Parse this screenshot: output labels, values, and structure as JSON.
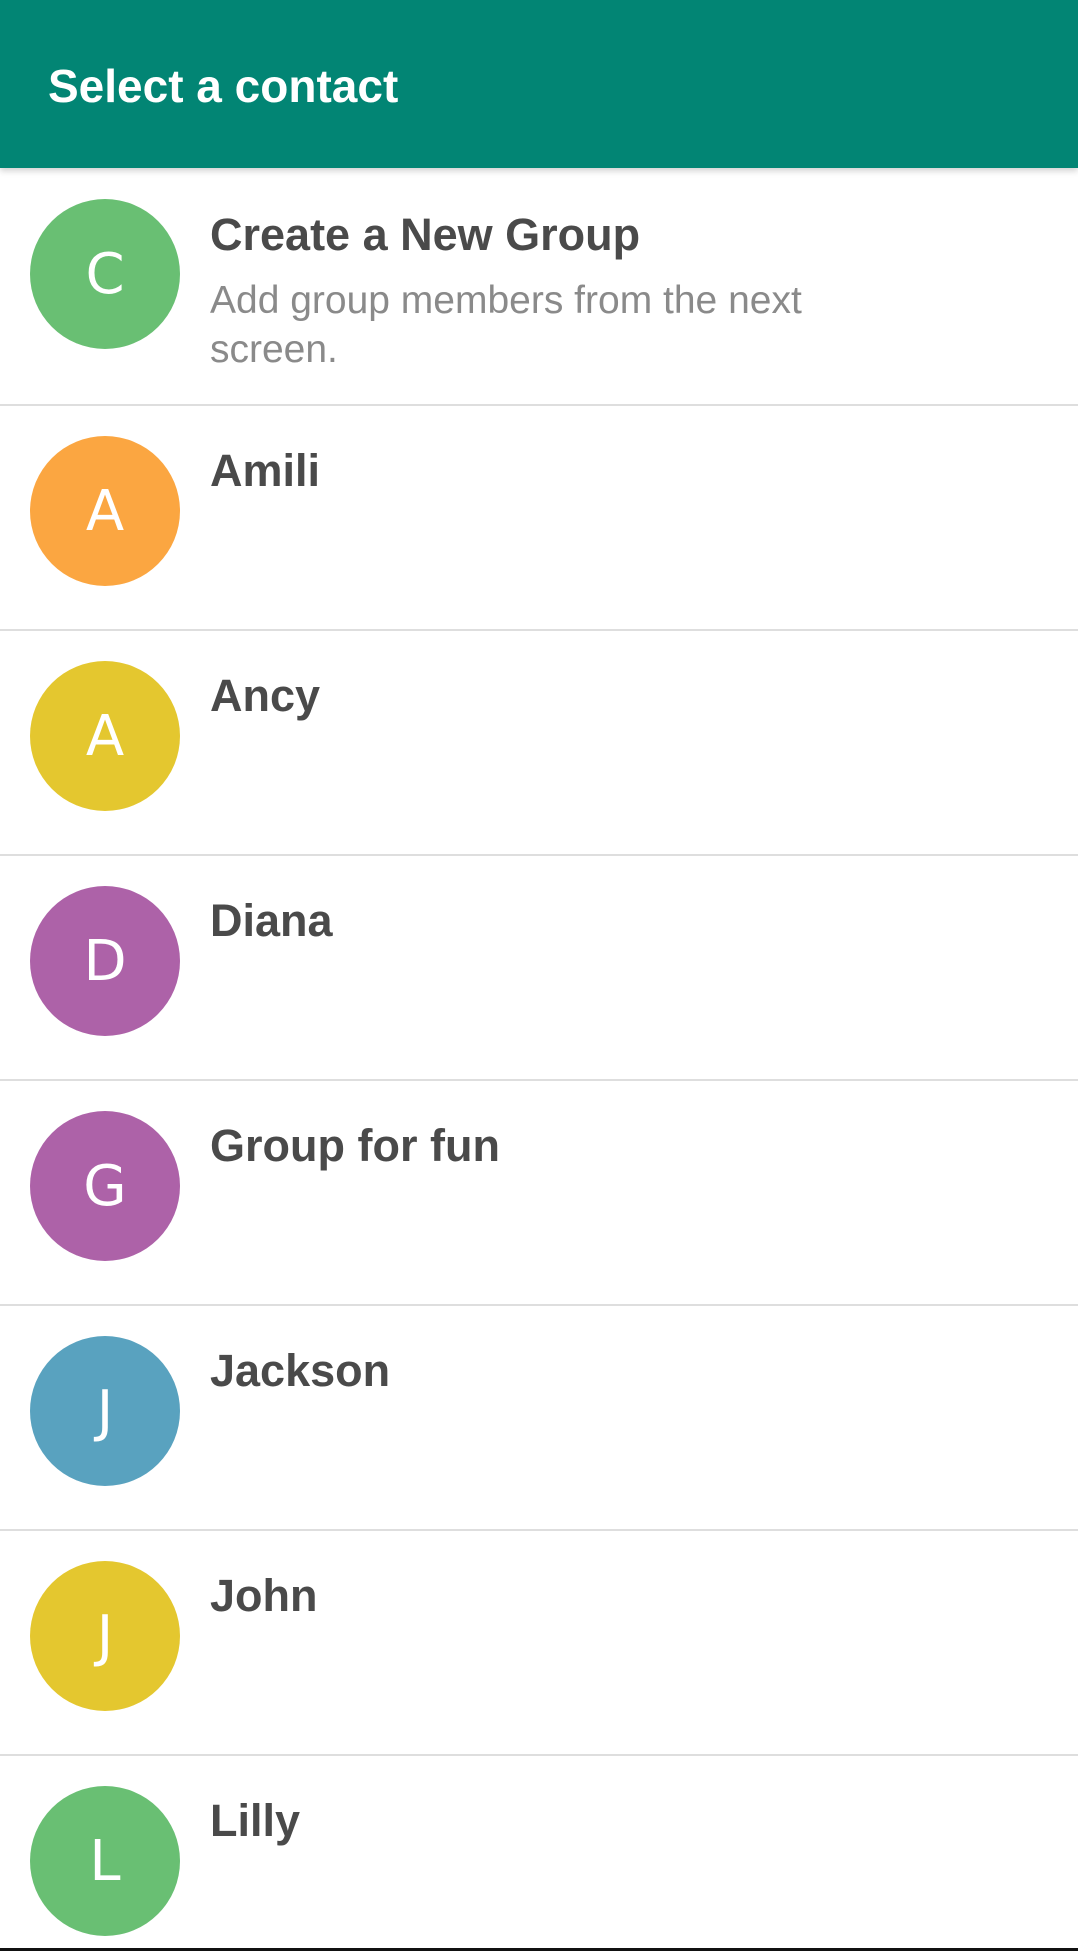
{
  "app_bar": {
    "title": "Select a contact",
    "color": "#028574"
  },
  "new_group": {
    "initial": "C",
    "title": "Create a New Group",
    "subtitle": "Add group members from the next screen.",
    "color": "#69BF73"
  },
  "contacts": [
    {
      "initial": "A",
      "name": "Amili",
      "color": "#FBA641"
    },
    {
      "initial": "A",
      "name": "Ancy",
      "color": "#E4C72F"
    },
    {
      "initial": "D",
      "name": "Diana",
      "color": "#AD62A8"
    },
    {
      "initial": "G",
      "name": "Group for fun",
      "color": "#AD62A8"
    },
    {
      "initial": "J",
      "name": "Jackson",
      "color": "#59A2BF"
    },
    {
      "initial": "J",
      "name": "John",
      "color": "#E4C72F"
    },
    {
      "initial": "L",
      "name": "Lilly",
      "color": "#69BF73"
    }
  ]
}
